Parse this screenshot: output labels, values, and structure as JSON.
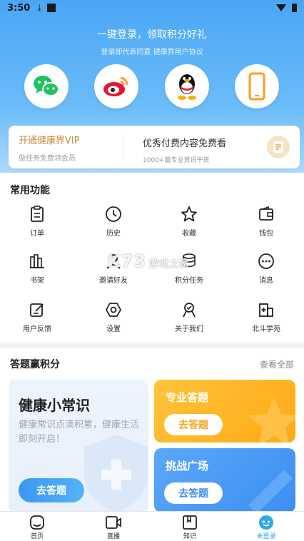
{
  "status": {
    "time": "3:50"
  },
  "login": {
    "title": "一键登录，领取积分好礼",
    "subtitle": "登录即代表同意 健康界用户协议",
    "providers": [
      "wechat-icon",
      "weibo-icon",
      "qq-icon",
      "phone-icon"
    ]
  },
  "vip": {
    "title": "开通健康界VIP",
    "desc": "做任务免费领会员",
    "right_title": "优秀付费内容免费看",
    "right_desc": "1000+篇专业资讯干货"
  },
  "functions": {
    "title": "常用功能",
    "items": [
      {
        "label": "订单",
        "icon": "order-icon"
      },
      {
        "label": "历史",
        "icon": "clock-icon"
      },
      {
        "label": "收藏",
        "icon": "star-icon"
      },
      {
        "label": "钱包",
        "icon": "wallet-icon"
      },
      {
        "label": "书架",
        "icon": "bookshelf-icon"
      },
      {
        "label": "邀请好友",
        "icon": "invite-icon"
      },
      {
        "label": "积分任务",
        "icon": "coins-icon"
      },
      {
        "label": "消息",
        "icon": "message-icon"
      },
      {
        "label": "用户反馈",
        "icon": "feedback-icon"
      },
      {
        "label": "设置",
        "icon": "settings-icon"
      },
      {
        "label": "关于我们",
        "icon": "about-icon"
      },
      {
        "label": "北斗学苑",
        "icon": "academy-icon"
      }
    ]
  },
  "quiz": {
    "title": "答题赢积分",
    "more": "查看全部",
    "health": {
      "title": "健康小常识",
      "desc": "健康常识点滴积累，健康生活即刻开启！",
      "button": "去答题"
    },
    "pro": {
      "title": "专业答题",
      "button": "去答题"
    },
    "challenge": {
      "title": "挑战广场",
      "button": "去答题"
    }
  },
  "watermark": {
    "text": "K73",
    "sub": "游戏之家"
  },
  "tabs": [
    {
      "label": "首页",
      "icon": "home-icon"
    },
    {
      "label": "直播",
      "icon": "live-icon"
    },
    {
      "label": "知识",
      "icon": "book-icon"
    },
    {
      "label": "未登录",
      "icon": "profile-icon",
      "active": true
    }
  ],
  "colors": {
    "primary": "#4aa6f5",
    "gold": "#c68a3e",
    "orange": "#ffb020",
    "blue": "#3d8ef3",
    "active_tab": "#2fa7e6"
  }
}
